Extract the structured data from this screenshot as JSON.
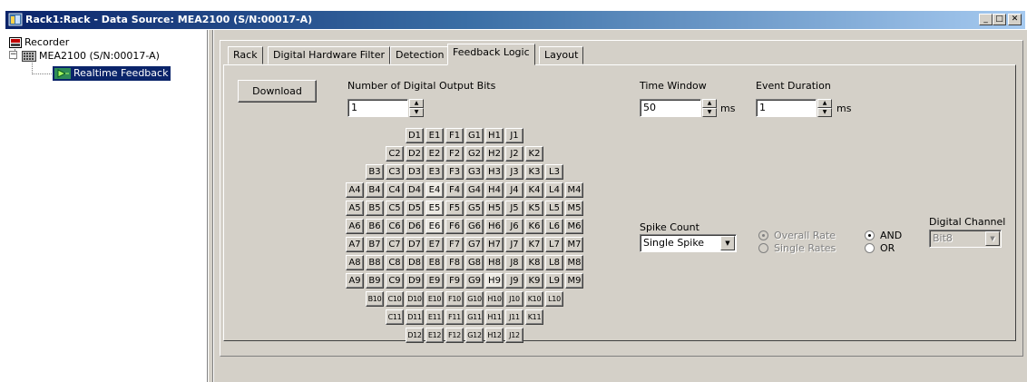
{
  "window": {
    "title": "Rack1:Rack - Data Source: MEA2100 (S/N:00017-A)",
    "minimize": "_",
    "maximize": "□",
    "close": "✕"
  },
  "tree": {
    "items": [
      {
        "label": "Recorder",
        "icon": "recorder-icon"
      },
      {
        "label": "MEA2100 (S/N:00017-A)",
        "icon": "device-icon"
      },
      {
        "label": "Realtime Feedback",
        "icon": "feedback-icon"
      }
    ]
  },
  "tabs": [
    {
      "label": "Rack"
    },
    {
      "label": "Digital Hardware Filter"
    },
    {
      "label": "Detection"
    },
    {
      "label": "Feedback Logic"
    },
    {
      "label": "Layout"
    }
  ],
  "active_tab": "Feedback Logic",
  "form": {
    "download_label": "Download",
    "num_bits_label": "Number of Digital Output Bits",
    "num_bits_value": "1",
    "time_window_label": "Time Window",
    "time_window_value": "50",
    "time_window_unit": "ms",
    "event_duration_label": "Event Duration",
    "event_duration_value": "1",
    "event_duration_unit": "ms",
    "spike_count_label": "Spike Count",
    "spike_count_value": "Single Spike",
    "overall_rate_label": "Overall Rate",
    "single_rates_label": "Single Rates",
    "and_label": "AND",
    "or_label": "OR",
    "digital_channel_label": "Digital Channel",
    "digital_channel_value": "Bit8"
  },
  "electrodes": {
    "rows": [
      {
        "indent": 3,
        "cells": [
          "D1",
          "E1",
          "F1",
          "G1",
          "H1",
          "J1"
        ]
      },
      {
        "indent": 2,
        "cells": [
          "C2",
          "D2",
          "E2",
          "F2",
          "G2",
          "H2",
          "J2",
          "K2"
        ]
      },
      {
        "indent": 1,
        "cells": [
          "B3",
          "C3",
          "D3",
          "E3",
          "F3",
          "G3",
          "H3",
          "J3",
          "K3",
          "L3"
        ]
      },
      {
        "indent": 0,
        "cells": [
          "A4",
          "B4",
          "C4",
          "D4",
          "E4",
          "F4",
          "G4",
          "H4",
          "J4",
          "K4",
          "L4",
          "M4"
        ]
      },
      {
        "indent": 0,
        "cells": [
          "A5",
          "B5",
          "C5",
          "D5",
          "E5",
          "F5",
          "G5",
          "H5",
          "J5",
          "K5",
          "L5",
          "M5"
        ]
      },
      {
        "indent": 0,
        "cells": [
          "A6",
          "B6",
          "C6",
          "D6",
          "E6",
          "F6",
          "G6",
          "H6",
          "J6",
          "K6",
          "L6",
          "M6"
        ]
      },
      {
        "indent": 0,
        "cells": [
          "A7",
          "B7",
          "C7",
          "D7",
          "E7",
          "F7",
          "G7",
          "H7",
          "J7",
          "K7",
          "L7",
          "M7"
        ]
      },
      {
        "indent": 0,
        "cells": [
          "A8",
          "B8",
          "C8",
          "D8",
          "E8",
          "F8",
          "G8",
          "H8",
          "J8",
          "K8",
          "L8",
          "M8"
        ]
      },
      {
        "indent": 0,
        "cells": [
          "A9",
          "B9",
          "C9",
          "D9",
          "E9",
          "F9",
          "G9",
          "H9",
          "J9",
          "K9",
          "L9",
          "M9"
        ]
      },
      {
        "indent": 1,
        "cells": [
          "B10",
          "C10",
          "D10",
          "E10",
          "F10",
          "G10",
          "H10",
          "J10",
          "K10",
          "L10"
        ]
      },
      {
        "indent": 2,
        "cells": [
          "C11",
          "D11",
          "E11",
          "F11",
          "G11",
          "H11",
          "J11",
          "K11"
        ]
      },
      {
        "indent": 3,
        "cells": [
          "D12",
          "E12",
          "F12",
          "G12",
          "H12",
          "J12"
        ]
      }
    ],
    "highlighted": [
      "E4",
      "E5",
      "E6",
      "H9"
    ]
  },
  "colors": {
    "titlebar_start": "#0a246a",
    "titlebar_end": "#a6caf0",
    "selection": "#0a246a",
    "face": "#d4d0c8"
  }
}
